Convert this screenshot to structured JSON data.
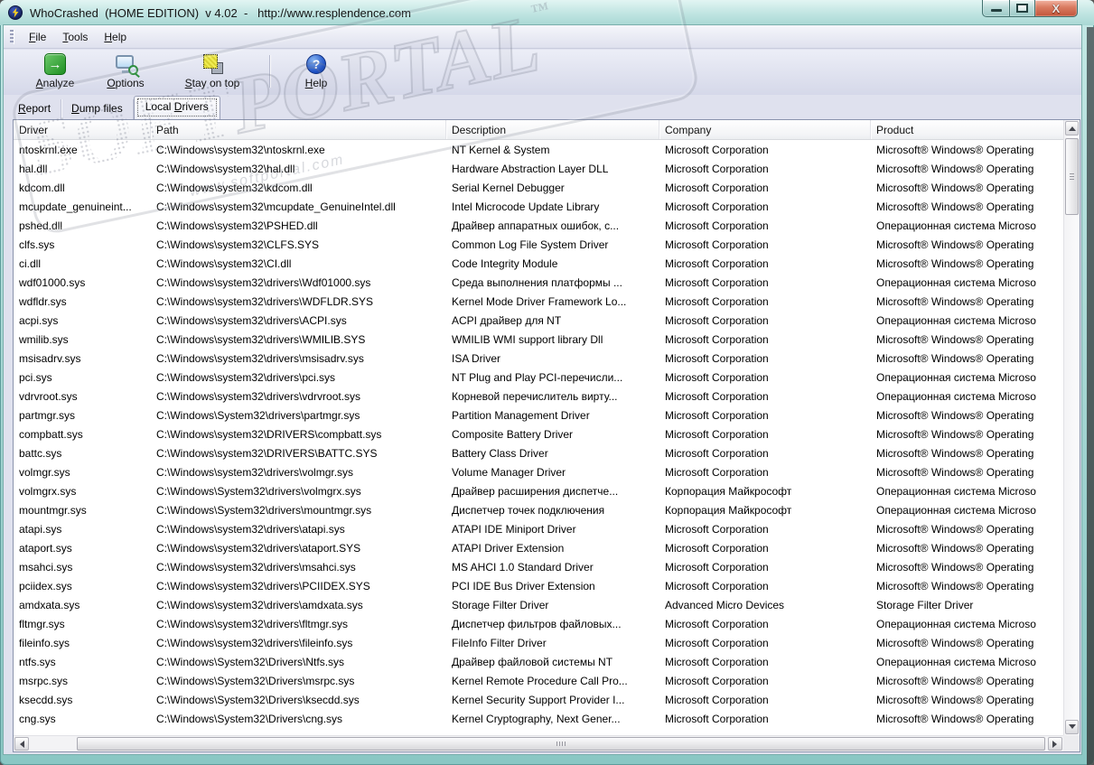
{
  "window": {
    "title": "WhoCrashed  (HOME EDITION)  v 4.02  -   http://www.resplendence.com"
  },
  "icons": {
    "analyze_arrow": "→",
    "help_question": "?",
    "close_glyph": "X"
  },
  "menu": {
    "items": [
      {
        "pre": "",
        "key": "F",
        "post": "ile"
      },
      {
        "pre": "",
        "key": "T",
        "post": "ools"
      },
      {
        "pre": "",
        "key": "H",
        "post": "elp"
      }
    ]
  },
  "toolbar": {
    "buttons": [
      {
        "pre": "",
        "key": "A",
        "post": "nalyze"
      },
      {
        "pre": "",
        "key": "O",
        "post": "ptions"
      },
      {
        "pre": "",
        "key": "S",
        "post": "tay on top"
      },
      {
        "pre": "",
        "key": "H",
        "post": "elp"
      }
    ]
  },
  "tabs": [
    {
      "pre": "",
      "key": "R",
      "post": "eport"
    },
    {
      "pre": "",
      "key": "D",
      "post": "ump files"
    },
    {
      "pre": "Local ",
      "key": "D",
      "post": "rivers"
    }
  ],
  "table": {
    "columns": [
      "Driver",
      "Path",
      "Description",
      "Company",
      "Product"
    ],
    "rows": [
      [
        "ntoskrnl.exe",
        "C:\\Windows\\system32\\ntoskrnl.exe",
        "NT Kernel & System",
        "Microsoft Corporation",
        "Microsoft® Windows® Operating"
      ],
      [
        "hal.dll",
        "C:\\Windows\\system32\\hal.dll",
        "Hardware Abstraction Layer DLL",
        "Microsoft Corporation",
        "Microsoft® Windows® Operating"
      ],
      [
        "kdcom.dll",
        "C:\\Windows\\system32\\kdcom.dll",
        "Serial Kernel Debugger",
        "Microsoft Corporation",
        "Microsoft® Windows® Operating"
      ],
      [
        "mcupdate_genuineint...",
        "C:\\Windows\\system32\\mcupdate_GenuineIntel.dll",
        "Intel Microcode Update Library",
        "Microsoft Corporation",
        "Microsoft® Windows® Operating"
      ],
      [
        "pshed.dll",
        "C:\\Windows\\system32\\PSHED.dll",
        "Драйвер аппаратных ошибок, с...",
        "Microsoft Corporation",
        "Операционная система Microso"
      ],
      [
        "clfs.sys",
        "C:\\Windows\\system32\\CLFS.SYS",
        "Common Log File System Driver",
        "Microsoft Corporation",
        "Microsoft® Windows® Operating"
      ],
      [
        "ci.dll",
        "C:\\Windows\\system32\\CI.dll",
        "Code Integrity Module",
        "Microsoft Corporation",
        "Microsoft® Windows® Operating"
      ],
      [
        "wdf01000.sys",
        "C:\\Windows\\system32\\drivers\\Wdf01000.sys",
        "Среда выполнения платформы ...",
        "Microsoft Corporation",
        "Операционная система Microso"
      ],
      [
        "wdfldr.sys",
        "C:\\Windows\\system32\\drivers\\WDFLDR.SYS",
        "Kernel Mode Driver Framework Lo...",
        "Microsoft Corporation",
        "Microsoft® Windows® Operating"
      ],
      [
        "acpi.sys",
        "C:\\Windows\\system32\\drivers\\ACPI.sys",
        "ACPI драйвер для NT",
        "Microsoft Corporation",
        "Операционная система Microso"
      ],
      [
        "wmilib.sys",
        "C:\\Windows\\system32\\drivers\\WMILIB.SYS",
        "WMILIB WMI support library Dll",
        "Microsoft Corporation",
        "Microsoft® Windows® Operating"
      ],
      [
        "msisadrv.sys",
        "C:\\Windows\\system32\\drivers\\msisadrv.sys",
        "ISA Driver",
        "Microsoft Corporation",
        "Microsoft® Windows® Operating"
      ],
      [
        "pci.sys",
        "C:\\Windows\\system32\\drivers\\pci.sys",
        "NT Plug and Play PCI-перечисли...",
        "Microsoft Corporation",
        "Операционная система Microso"
      ],
      [
        "vdrvroot.sys",
        "C:\\Windows\\system32\\drivers\\vdrvroot.sys",
        "Корневой перечислитель вирту...",
        "Microsoft Corporation",
        "Операционная система Microso"
      ],
      [
        "partmgr.sys",
        "C:\\Windows\\System32\\drivers\\partmgr.sys",
        "Partition Management Driver",
        "Microsoft Corporation",
        "Microsoft® Windows® Operating"
      ],
      [
        "compbatt.sys",
        "C:\\Windows\\system32\\DRIVERS\\compbatt.sys",
        "Composite Battery Driver",
        "Microsoft Corporation",
        "Microsoft® Windows® Operating"
      ],
      [
        "battc.sys",
        "C:\\Windows\\system32\\DRIVERS\\BATTC.SYS",
        "Battery Class Driver",
        "Microsoft Corporation",
        "Microsoft® Windows® Operating"
      ],
      [
        "volmgr.sys",
        "C:\\Windows\\system32\\drivers\\volmgr.sys",
        "Volume Manager Driver",
        "Microsoft Corporation",
        "Microsoft® Windows® Operating"
      ],
      [
        "volmgrx.sys",
        "C:\\Windows\\System32\\drivers\\volmgrx.sys",
        "Драйвер расширения диспетче...",
        "Корпорация Майкрософт",
        "Операционная система Microso"
      ],
      [
        "mountmgr.sys",
        "C:\\Windows\\System32\\drivers\\mountmgr.sys",
        "Диспетчер точек подключения",
        "Корпорация Майкрософт",
        "Операционная система Microso"
      ],
      [
        "atapi.sys",
        "C:\\Windows\\system32\\drivers\\atapi.sys",
        "ATAPI IDE Miniport Driver",
        "Microsoft Corporation",
        "Microsoft® Windows® Operating"
      ],
      [
        "ataport.sys",
        "C:\\Windows\\system32\\drivers\\ataport.SYS",
        "ATAPI Driver Extension",
        "Microsoft Corporation",
        "Microsoft® Windows® Operating"
      ],
      [
        "msahci.sys",
        "C:\\Windows\\system32\\drivers\\msahci.sys",
        "MS AHCI 1.0 Standard Driver",
        "Microsoft Corporation",
        "Microsoft® Windows® Operating"
      ],
      [
        "pciidex.sys",
        "C:\\Windows\\system32\\drivers\\PCIIDEX.SYS",
        "PCI IDE Bus Driver Extension",
        "Microsoft Corporation",
        "Microsoft® Windows® Operating"
      ],
      [
        "amdxata.sys",
        "C:\\Windows\\system32\\drivers\\amdxata.sys",
        "Storage Filter Driver",
        "Advanced Micro Devices",
        "Storage Filter Driver"
      ],
      [
        "fltmgr.sys",
        "C:\\Windows\\system32\\drivers\\fltmgr.sys",
        "Диспетчер фильтров файловых...",
        "Microsoft Corporation",
        "Операционная система Microso"
      ],
      [
        "fileinfo.sys",
        "C:\\Windows\\system32\\drivers\\fileinfo.sys",
        "FileInfo Filter Driver",
        "Microsoft Corporation",
        "Microsoft® Windows® Operating"
      ],
      [
        "ntfs.sys",
        "C:\\Windows\\System32\\Drivers\\Ntfs.sys",
        "Драйвер файловой системы NT",
        "Microsoft Corporation",
        "Операционная система Microso"
      ],
      [
        "msrpc.sys",
        "C:\\Windows\\System32\\Drivers\\msrpc.sys",
        "Kernel Remote Procedure Call Pro...",
        "Microsoft Corporation",
        "Microsoft® Windows® Operating"
      ],
      [
        "ksecdd.sys",
        "C:\\Windows\\System32\\Drivers\\ksecdd.sys",
        "Kernel Security Support Provider I...",
        "Microsoft Corporation",
        "Microsoft® Windows® Operating"
      ],
      [
        "cng.sys",
        "C:\\Windows\\System32\\Drivers\\cng.sys",
        "Kernel Cryptography, Next Gener...",
        "Microsoft Corporation",
        "Microsoft® Windows® Operating"
      ]
    ]
  },
  "watermark": {
    "soft": "SOFT",
    "portal": "PORTAL",
    "tm": "™",
    "url": "www.softportal.com"
  },
  "colors": {
    "titlebar_teal": "#bfe4e1",
    "close_button_red": "#c2553a",
    "analyze_green": "#2e9e2e",
    "help_blue": "#1c4fc4",
    "window_border_teal": "#9fd2cf",
    "list_background": "#ffffff",
    "text": "#000000"
  }
}
